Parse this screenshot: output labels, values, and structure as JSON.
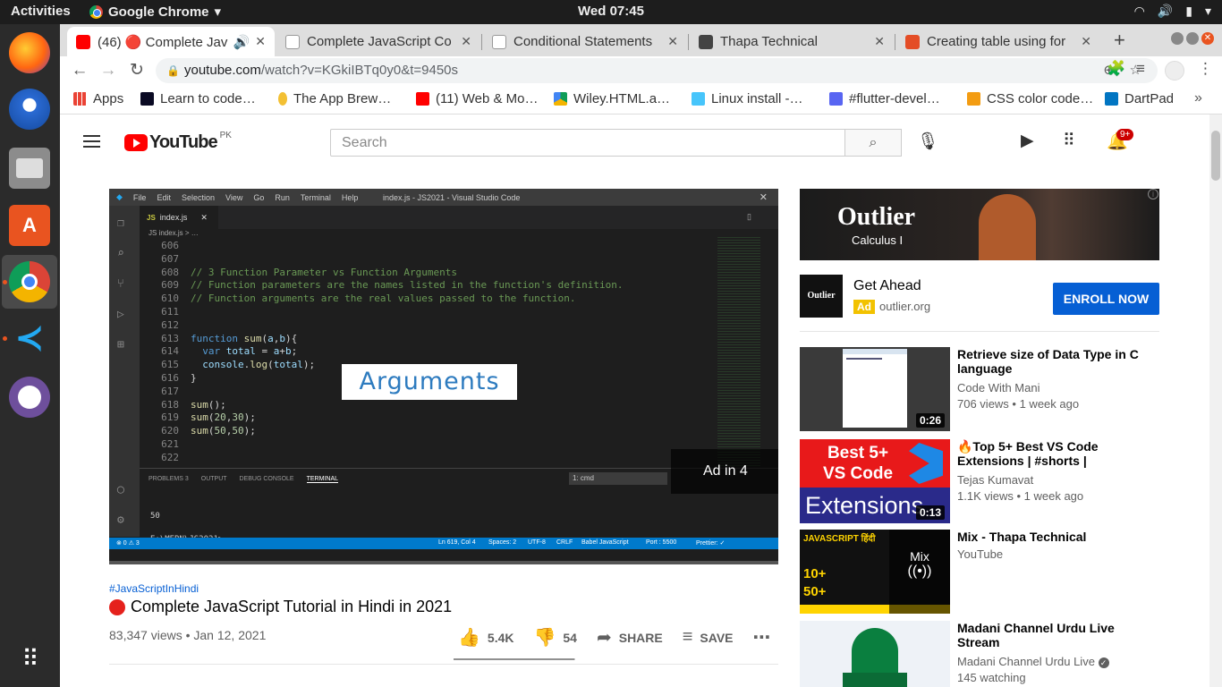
{
  "topbar": {
    "activities": "Activities",
    "app_name": "Google Chrome",
    "clock": "Wed 07:45"
  },
  "tabs": [
    {
      "title": "(46) 🔴 Complete Jav",
      "active": true,
      "favicon": "youtube-icon"
    },
    {
      "title": "Complete JavaScript Co",
      "active": false,
      "favicon": "page-icon"
    },
    {
      "title": "Conditional Statements",
      "active": false,
      "favicon": "page-icon"
    },
    {
      "title": "Thapa Technical",
      "active": false,
      "favicon": "youtube-icon"
    },
    {
      "title": "Creating table using for",
      "active": false,
      "favicon": "html5-icon"
    }
  ],
  "omnibar": {
    "url_host": "youtube.com",
    "url_path": "/watch?v=KGkiIBTq0y0&t=9450s"
  },
  "bookmarks": [
    {
      "label": "Apps",
      "icon": "apps-grid-icon"
    },
    {
      "label": "Learn to code…",
      "icon": "freecodecamp-icon"
    },
    {
      "label": "The App Brew…",
      "icon": "app-brewery-icon"
    },
    {
      "label": "(11) Web & Mo…",
      "icon": "youtube-icon"
    },
    {
      "label": "Wiley.HTML.a…",
      "icon": "google-drive-icon"
    },
    {
      "label": "Linux install -…",
      "icon": "flutter-icon"
    },
    {
      "label": "#flutter-devel…",
      "icon": "discord-icon"
    },
    {
      "label": "CSS color code…",
      "icon": "r-icon"
    },
    {
      "label": "DartPad",
      "icon": "dart-icon"
    }
  ],
  "yt_header": {
    "logo_word": "YouTube",
    "country": "PK",
    "search_placeholder": "Search",
    "notification_count": "9+"
  },
  "player": {
    "vs_menu": [
      "File",
      "Edit",
      "Selection",
      "View",
      "Go",
      "Run",
      "Terminal",
      "Help"
    ],
    "vs_window_title": "index.js - JS2021 - Visual Studio Code",
    "vs_tab": "index.js",
    "vs_crumb": "JS index.js > …",
    "code_lines": [
      {
        "n": "606",
        "t": ""
      },
      {
        "n": "607",
        "t": ""
      },
      {
        "n": "608",
        "t": "// 3 Function Parameter vs Function Arguments",
        "cls": "cm"
      },
      {
        "n": "609",
        "t": "// Function parameters are the names listed in the function's definition.",
        "cls": "cm"
      },
      {
        "n": "610",
        "t": "// Function arguments are the real values passed to the function.",
        "cls": "cm"
      },
      {
        "n": "611",
        "t": ""
      },
      {
        "n": "612",
        "t": ""
      },
      {
        "n": "613",
        "t": "function sum(a,b){"
      },
      {
        "n": "614",
        "t": "  var total = a+b;"
      },
      {
        "n": "615",
        "t": "  console.log(total);"
      },
      {
        "n": "616",
        "t": "}"
      },
      {
        "n": "617",
        "t": ""
      },
      {
        "n": "618",
        "t": "sum();"
      },
      {
        "n": "619",
        "t": "sum(20,30);"
      },
      {
        "n": "620",
        "t": "sum(50,50);"
      },
      {
        "n": "621",
        "t": ""
      },
      {
        "n": "622",
        "t": ""
      }
    ],
    "overlay_caption": "Arguments",
    "panel_tabs": [
      "PROBLEMS 3",
      "OUTPUT",
      "DEBUG CONSOLE",
      "TERMINAL"
    ],
    "terminal_selector": "1: cmd",
    "terminal_output": "50",
    "terminal_prompt": "E:\\MERN\\JS2021>",
    "status_left": "⊗ 0 ⚠ 3",
    "status_pos": "Ln 619, Col 4",
    "status_spaces": "Spaces: 2",
    "status_enc": "UTF-8",
    "status_eol": "CRLF",
    "status_lang": "Babel JavaScript",
    "status_port": "Port : 5500",
    "status_prettier": "Prettier: ✓",
    "ad_countdown": "Ad in 4"
  },
  "video": {
    "hashtag": "#JavaScriptInHindi",
    "title": "Complete JavaScript Tutorial in Hindi in 2021",
    "meta": "83,347 views • Jan 12, 2021",
    "likes": "5.4K",
    "dislikes": "54",
    "share_label": "SHARE",
    "save_label": "SAVE"
  },
  "ad": {
    "banner_brand": "Outlier",
    "banner_sub": "Calculus I",
    "logo_text": "Outlier",
    "headline": "Get Ahead",
    "label": "Ad",
    "domain": "outlier.org",
    "cta": "ENROLL NOW"
  },
  "recommendations": [
    {
      "title": "Retrieve size of Data Type in C language",
      "channel": "Code With Mani",
      "meta": "706 views • 1 week ago",
      "duration": "0:26"
    },
    {
      "title": "🔥Top 5+ Best VS Code Extensions | #shorts |",
      "channel": "Tejas Kumavat",
      "meta": "1.1K views • 1 week ago",
      "duration": "0:13",
      "thumb_top": "Best 5+",
      "thumb_mid": "VS Code",
      "thumb_bottom": "Extensions"
    },
    {
      "title": "Mix - Thapa Technical",
      "channel": "YouTube",
      "meta": "",
      "thumb_label": "Mix",
      "thumb_heading": "JAVASCRIPT हिंदी"
    },
    {
      "title": "Madani Channel Urdu Live Stream",
      "channel": "Madani Channel Urdu Live",
      "meta": "145 watching"
    }
  ],
  "colors": {
    "yt_red": "#ff0000",
    "link_blue": "#065fd4",
    "vs_status_blue": "#007acc"
  }
}
